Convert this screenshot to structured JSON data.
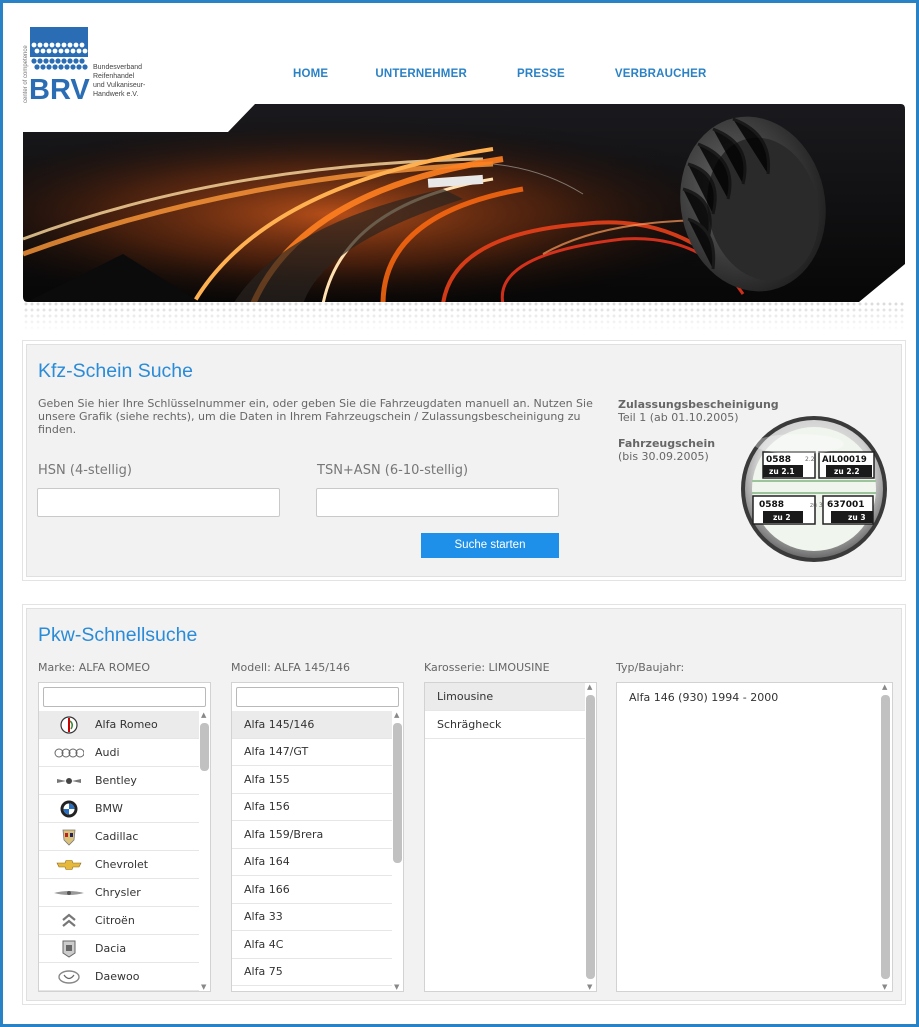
{
  "logo": {
    "abbr": "BRV",
    "tagline": "center of competence",
    "org": [
      "Bundesverband",
      "Reifenhandel",
      "und Vulkaniseur-",
      "Handwerk e.V."
    ]
  },
  "nav": [
    {
      "label": "HOME"
    },
    {
      "label": "UNTERNEHMER"
    },
    {
      "label": "PRESSE"
    },
    {
      "label": "VERBRAUCHER"
    }
  ],
  "kfz": {
    "title": "Kfz-Schein Suche",
    "intro": "Geben Sie hier Ihre Schlüsselnummer ein, oder geben Sie die Fahrzeugdaten manuell an. Nutzen Sie unsere Grafik (siehe rechts), um die Daten in Ihrem Fahrzeugschein / Zulassungsbescheinigung zu finden.",
    "hsn_label": "HSN (4-stellig)",
    "tsn_label": "TSN+ASN (6-10-stellig)",
    "hsn_value": "",
    "tsn_value": "",
    "search_button": "Suche starten",
    "side": {
      "zb_title": "Zulassungsbescheinigung",
      "zb_sub": "Teil 1 (ab 01.10.2005)",
      "fs_title": "Fahrzeugschein",
      "fs_sub": "(bis 30.09.2005)"
    },
    "graphic": {
      "v1": "0588",
      "v1_lbl": "zu 2.1",
      "v1b": "2.2",
      "v2": "AIL00019",
      "v2_lbl": "zu 2.2",
      "v3": "0588",
      "v3_lbl": "zu 2",
      "v3b": "zu 3",
      "v4": "637001",
      "v4_lbl": "zu 3"
    }
  },
  "pkw": {
    "title": "Pkw-Schnellsuche",
    "marke_label": "Marke: ALFA ROMEO",
    "modell_label": "Modell: ALFA 145/146",
    "karosserie_label": "Karosserie: LIMOUSINE",
    "typ_label": "Typ/Baujahr:",
    "marke_filter": "",
    "modell_filter": "",
    "marken": [
      {
        "name": "Alfa Romeo",
        "icon": "alfa-romeo-logo-icon"
      },
      {
        "name": "Audi",
        "icon": "audi-logo-icon"
      },
      {
        "name": "Bentley",
        "icon": "bentley-logo-icon"
      },
      {
        "name": "BMW",
        "icon": "bmw-logo-icon"
      },
      {
        "name": "Cadillac",
        "icon": "cadillac-logo-icon"
      },
      {
        "name": "Chevrolet",
        "icon": "chevrolet-logo-icon"
      },
      {
        "name": "Chrysler",
        "icon": "chrysler-logo-icon"
      },
      {
        "name": "Citroën",
        "icon": "citroen-logo-icon"
      },
      {
        "name": "Dacia",
        "icon": "dacia-logo-icon"
      },
      {
        "name": "Daewoo",
        "icon": "daewoo-logo-icon"
      }
    ],
    "modelle": [
      "Alfa 145/146",
      "Alfa 147/GT",
      "Alfa 155",
      "Alfa 156",
      "Alfa 159/Brera",
      "Alfa 164",
      "Alfa 166",
      "Alfa 33",
      "Alfa 4C",
      "Alfa 75"
    ],
    "karosserien": [
      "Limousine",
      "Schrägheck"
    ],
    "typen": [
      "Alfa 146 (930) 1994 - 2000"
    ]
  }
}
